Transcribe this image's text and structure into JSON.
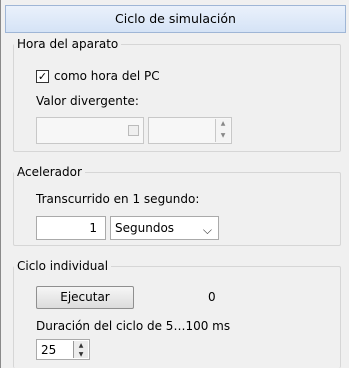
{
  "title": "Ciclo de simulación",
  "hora": {
    "legend": "Hora del aparato",
    "checkbox_label": "como hora del PC",
    "checkbox_checked": true,
    "divergent_label": "Valor divergente:",
    "date_value": "",
    "time_value": ""
  },
  "acelerador": {
    "legend": "Acelerador",
    "label": "Transcurrido en 1 segundo:",
    "value": "1",
    "unit": "Segundos"
  },
  "ciclo": {
    "legend": "Ciclo individual",
    "button_label": "Ejecutar",
    "count": "0",
    "duration_label": "Duración del ciclo de 5…100 ms",
    "duration_value": "25"
  }
}
